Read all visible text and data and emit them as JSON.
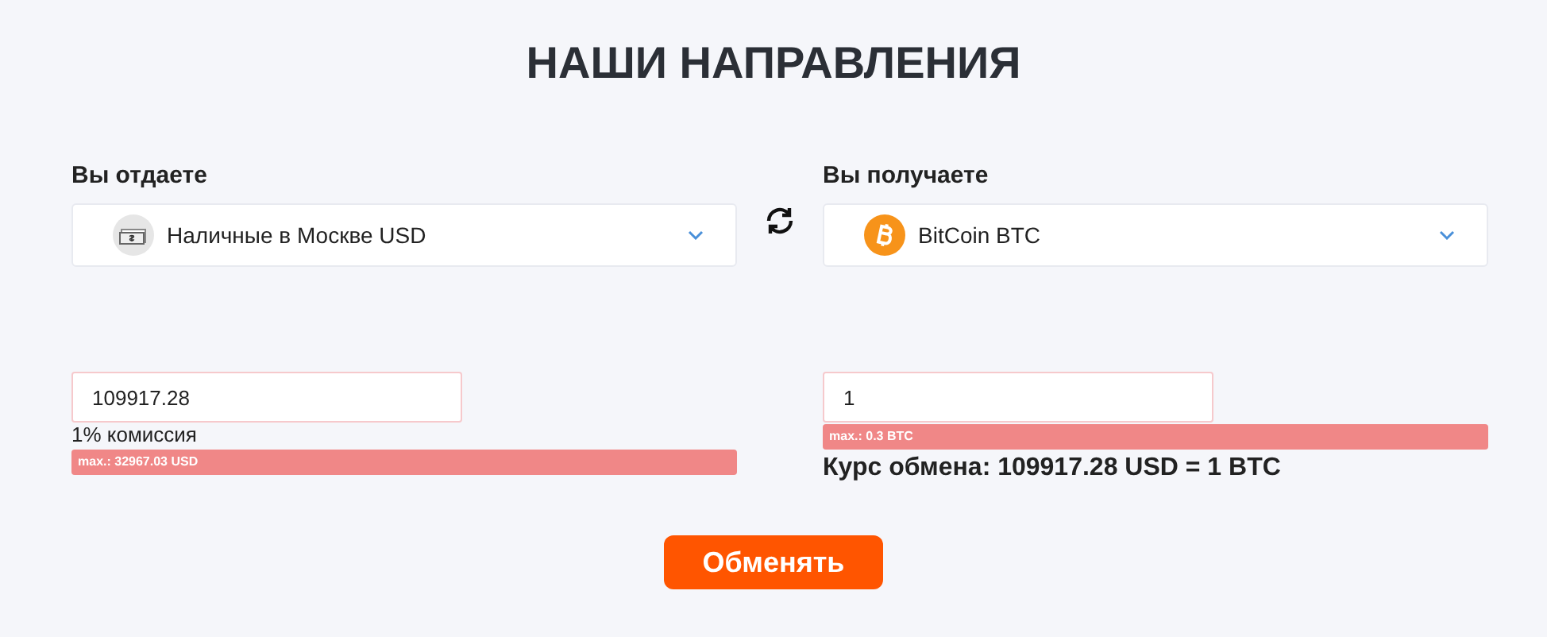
{
  "title": "НАШИ НАПРАВЛЕНИЯ",
  "give": {
    "label": "Вы отдаете",
    "currency": "Наличные в Москве USD",
    "kind": "cash",
    "amount": "109917.28",
    "commission": "1% комиссия",
    "limit": "max.: 32967.03 USD"
  },
  "receive": {
    "label": "Вы получаете",
    "currency": "BitCoin BTC",
    "kind": "bitcoin",
    "amount": "1",
    "limit": "max.: 0.3 BTC",
    "rate": "Курс обмена: 109917.28 USD = 1 BTC"
  },
  "submit": "Обменять"
}
